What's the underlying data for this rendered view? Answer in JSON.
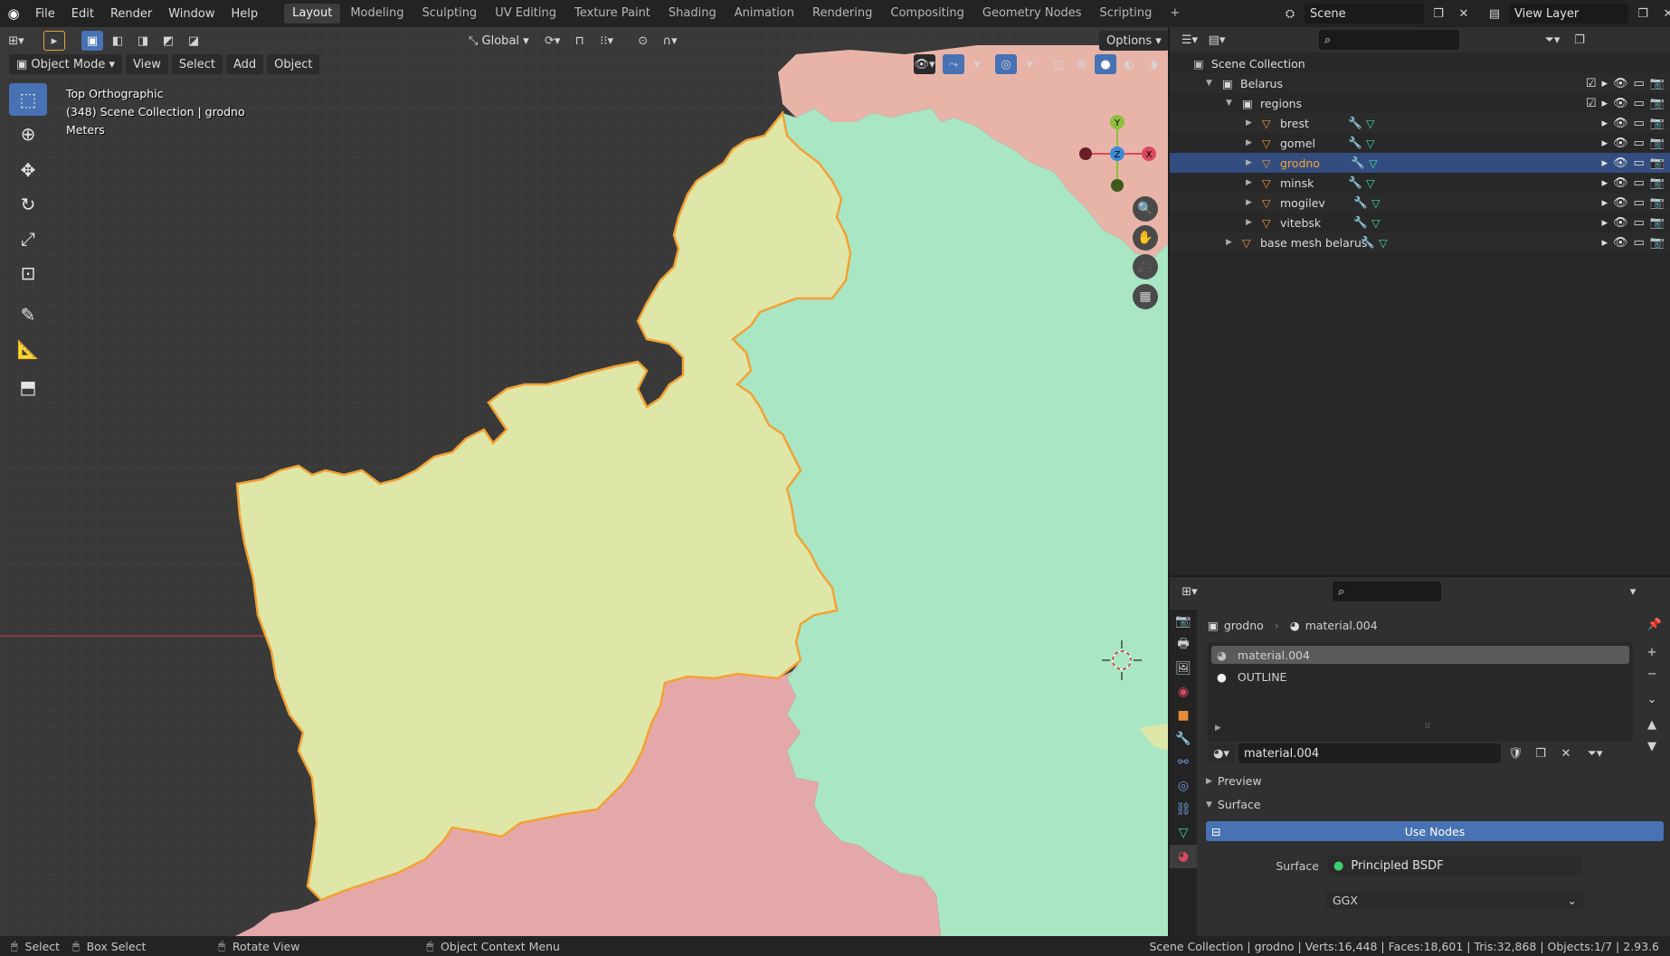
{
  "menu": {
    "app_icon": "blender-logo-icon",
    "items": [
      "File",
      "Edit",
      "Render",
      "Window",
      "Help"
    ]
  },
  "workspaces": [
    "Layout",
    "Modeling",
    "Sculpting",
    "UV Editing",
    "Texture Paint",
    "Shading",
    "Animation",
    "Rendering",
    "Compositing",
    "Geometry Nodes",
    "Scripting"
  ],
  "active_workspace": "Layout",
  "scene": {
    "label": "Scene",
    "view_layer": "View Layer"
  },
  "viewport": {
    "header": {
      "mode": "Object Mode",
      "menus": [
        "View",
        "Select",
        "Add",
        "Object"
      ],
      "orientation": "Global",
      "options": "Options"
    },
    "info": {
      "line1": "Top Orthographic",
      "line2": "(348) Scene Collection | grodno",
      "line3": "Meters"
    },
    "gizmo": {
      "y": "Y",
      "z": "Z",
      "x": "X"
    },
    "colors": {
      "background": "#3a3a3a",
      "yellow_region": "#dfe7a8",
      "green_region": "#a9e6c4",
      "pink_region": "#e5a8a8",
      "salmon_region": "#e8b4a8",
      "outline": "#f0a030"
    }
  },
  "outliner": {
    "root": "Scene Collection",
    "rows": [
      {
        "name": "Belarus",
        "type": "collection",
        "depth": 1,
        "expanded": true,
        "checkbox": true
      },
      {
        "name": "regions",
        "type": "collection",
        "depth": 2,
        "expanded": true,
        "checkbox": true
      },
      {
        "name": "brest",
        "type": "mesh",
        "depth": 3
      },
      {
        "name": "gomel",
        "type": "mesh",
        "depth": 3
      },
      {
        "name": "grodno",
        "type": "mesh",
        "depth": 3,
        "selected": true
      },
      {
        "name": "minsk",
        "type": "mesh",
        "depth": 3
      },
      {
        "name": "mogilev",
        "type": "mesh",
        "depth": 3
      },
      {
        "name": "vitebsk",
        "type": "mesh",
        "depth": 3
      },
      {
        "name": "base mesh belarus",
        "type": "mesh",
        "depth": 2
      }
    ]
  },
  "properties": {
    "breadcrumb": {
      "object": "grodno",
      "material": "material.004"
    },
    "slots": [
      "material.004",
      "OUTLINE"
    ],
    "material_field": "material.004",
    "panels": {
      "preview": "Preview",
      "surface": "Surface"
    },
    "use_nodes": "Use Nodes",
    "surface_label": "Surface",
    "surface_value": "Principled BSDF",
    "distribution": "GGX"
  },
  "status": {
    "select": "Select",
    "box_select": "Box Select",
    "rotate": "Rotate View",
    "context": "Object Context Menu",
    "stats": "Scene Collection | grodno | Verts:16,448 | Faces:18,601 | Tris:32,868 | Objects:1/7 | 2.93.6"
  }
}
